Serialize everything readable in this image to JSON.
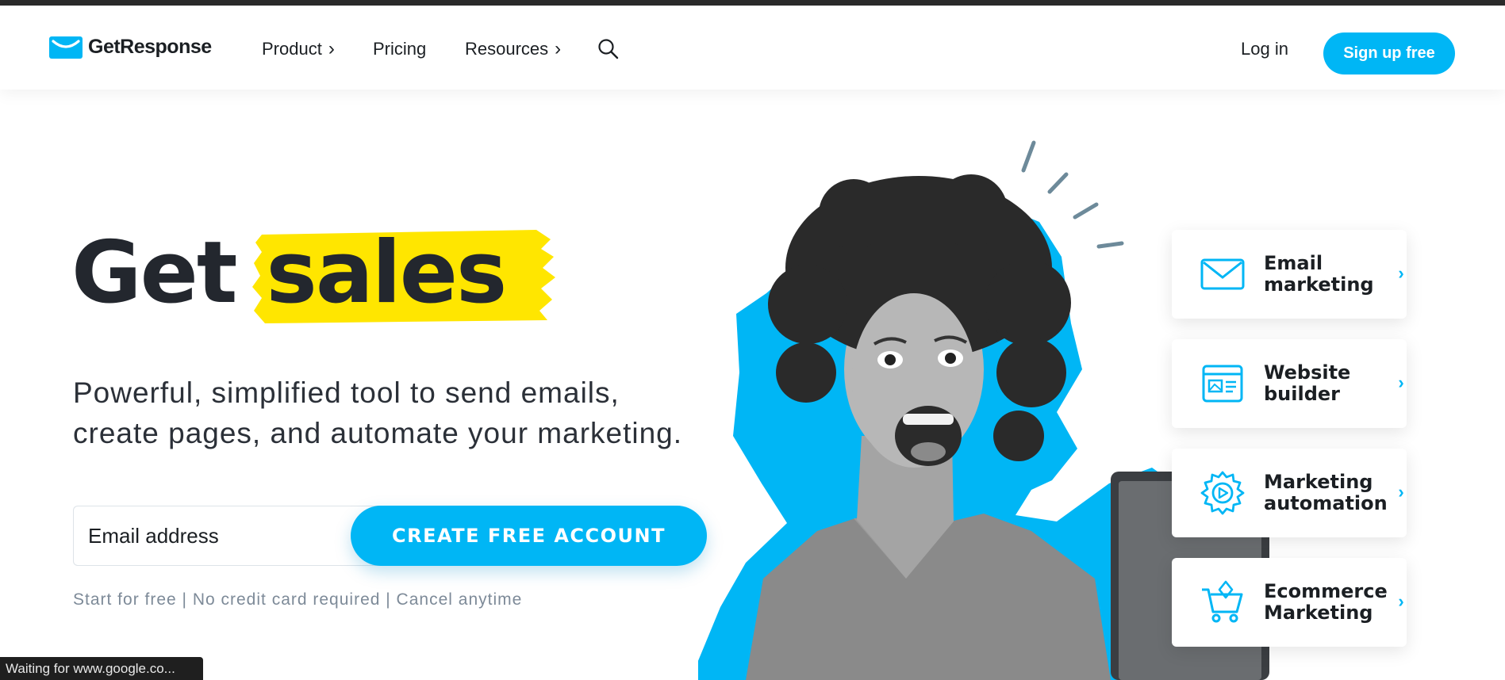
{
  "brand": {
    "name": "GetResponse",
    "accent_color": "#00b6f5",
    "highlight_color": "#ffe600"
  },
  "nav": {
    "items": [
      {
        "label": "Product",
        "chevron": "›"
      },
      {
        "label": "Pricing"
      },
      {
        "label": "Resources",
        "chevron": "›"
      }
    ],
    "search_icon": "search-icon",
    "login_label": "Log in",
    "signup_label": "Sign up free"
  },
  "hero": {
    "title_plain": "Get",
    "title_highlight": "sales",
    "subtitle_line1": "Powerful, simplified tool to send emails,",
    "subtitle_line2": "create pages, and automate your marketing.",
    "email_placeholder": "Email address",
    "cta_label": "CREATE FREE ACCOUNT",
    "disclaimer": "Start for free | No credit card required | Cancel anytime"
  },
  "features": [
    {
      "label_line1": "Email",
      "label_line2": "marketing",
      "icon": "envelope-icon",
      "arrow": "›"
    },
    {
      "label_line1": "Website",
      "label_line2": "builder",
      "icon": "website-builder-icon",
      "arrow": "›"
    },
    {
      "label_line1": "Marketing",
      "label_line2": "automation",
      "icon": "gear-play-icon",
      "arrow": "›"
    },
    {
      "label_line1": "Ecommerce",
      "label_line2": "Marketing",
      "icon": "shopping-cart-icon",
      "arrow": "›"
    }
  ],
  "browser_status": "Waiting for www.google.co..."
}
